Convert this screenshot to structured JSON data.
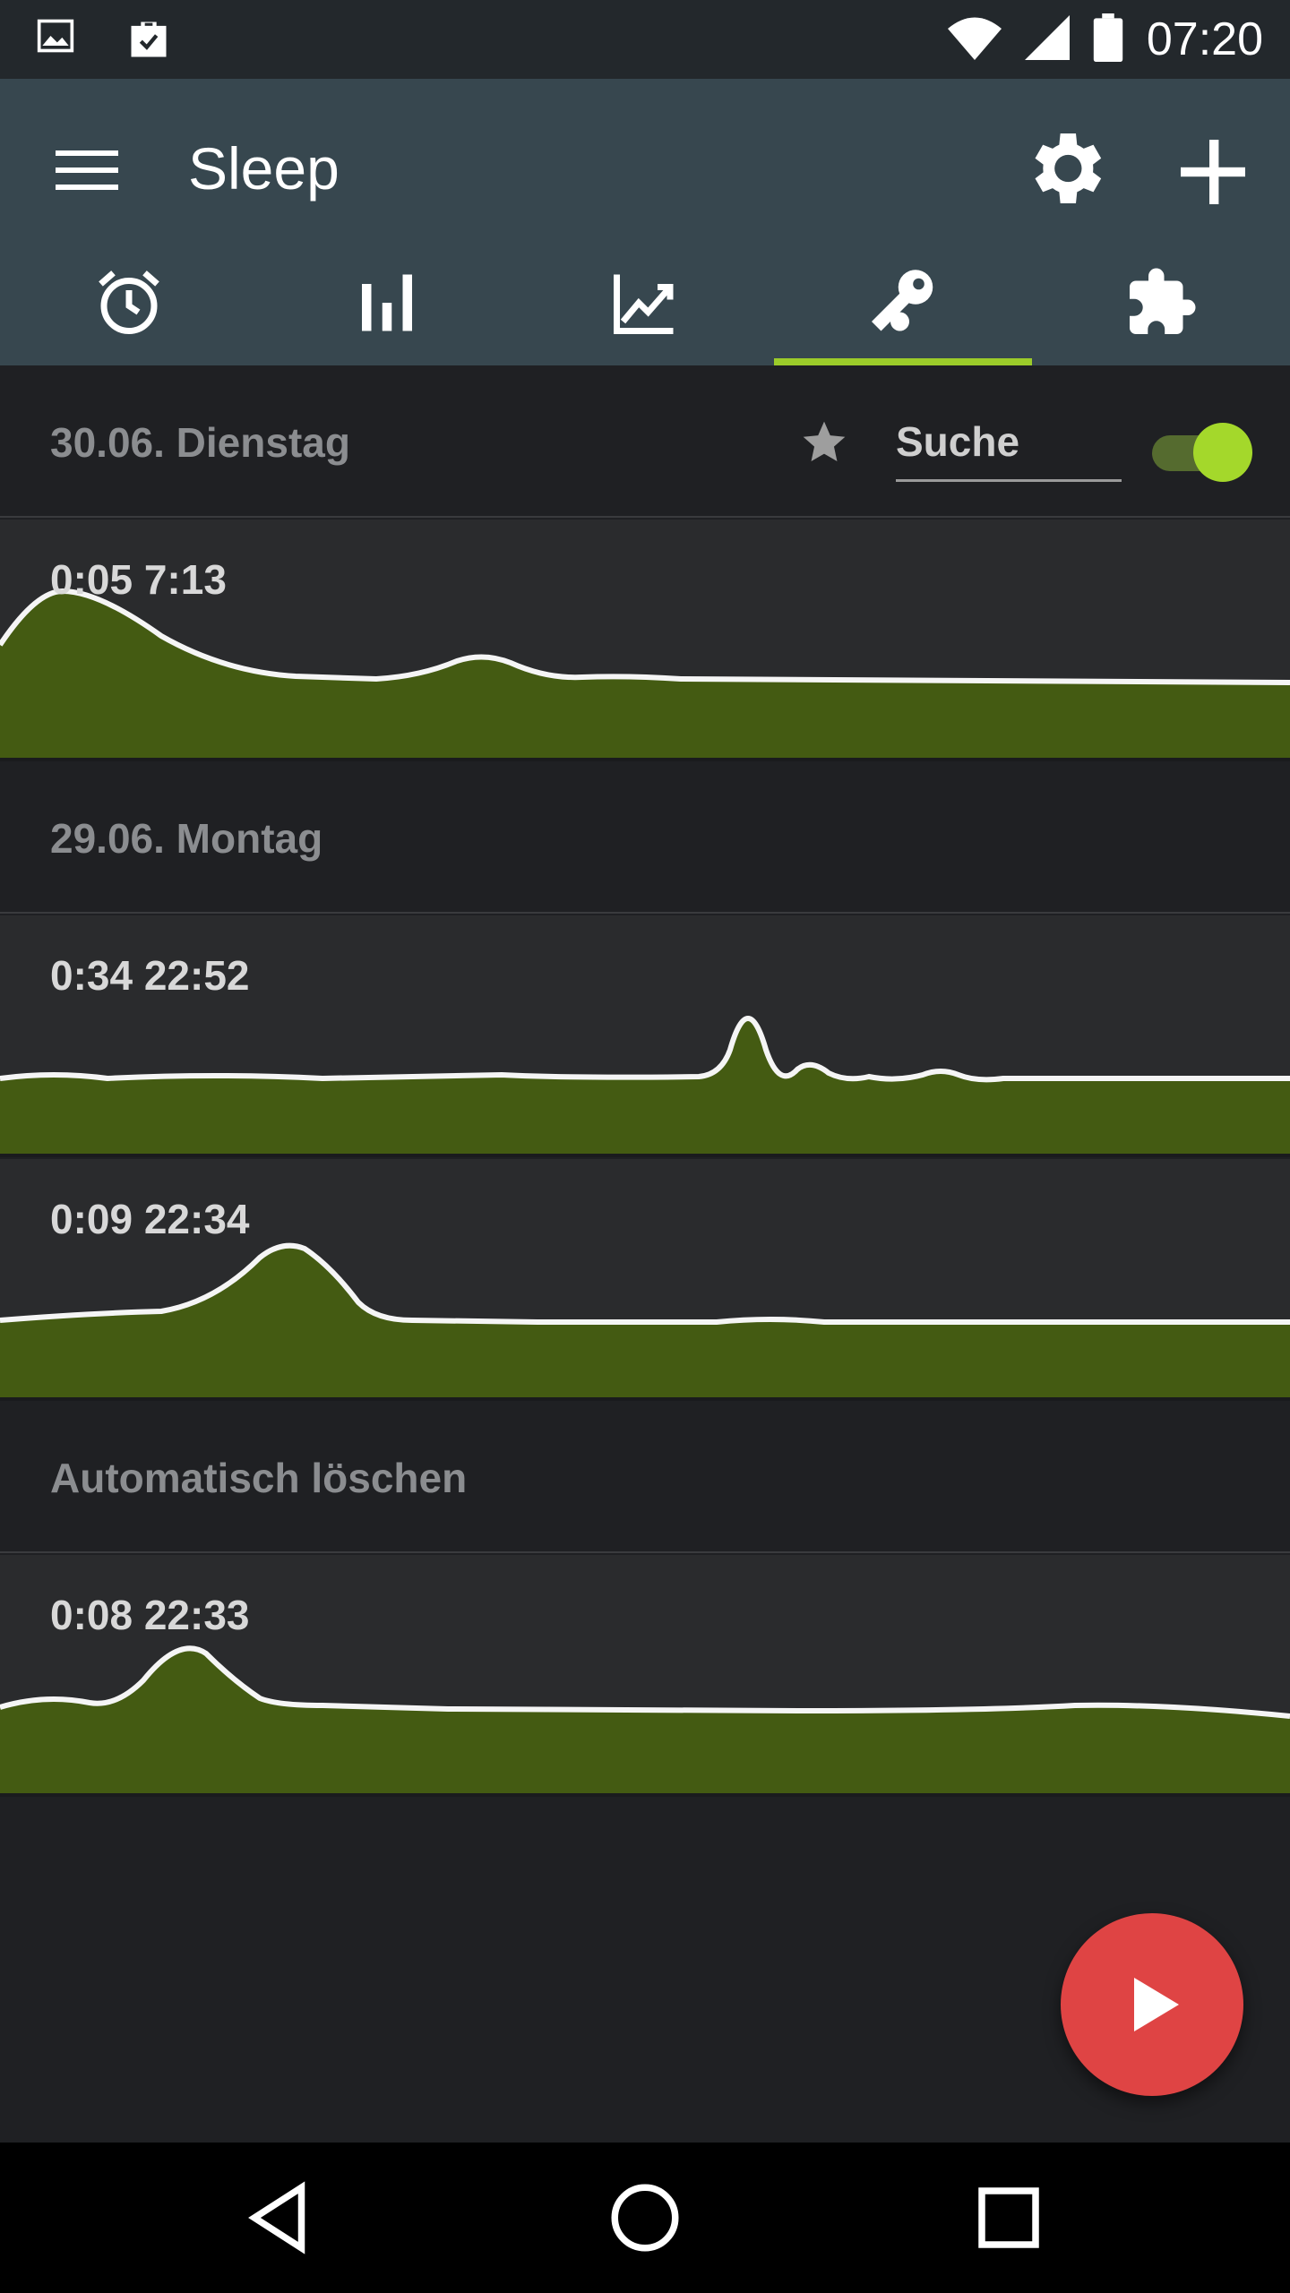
{
  "status_bar": {
    "time": "07:20",
    "icons": [
      "image-icon",
      "briefcase-check-icon",
      "wifi-icon",
      "signal-icon",
      "battery-icon"
    ]
  },
  "app_bar": {
    "title": "Sleep",
    "actions": [
      "settings-icon",
      "add-icon"
    ],
    "tabs": [
      {
        "name": "alarm-icon",
        "active": false
      },
      {
        "name": "bar-chart-icon",
        "active": false
      },
      {
        "name": "trend-chart-icon",
        "active": false
      },
      {
        "name": "key-icon",
        "active": true
      },
      {
        "name": "puzzle-icon",
        "active": false
      }
    ],
    "accent": "#9ccc2a",
    "background": "#37474f"
  },
  "list": {
    "header_1": {
      "label": "30.06. Dienstag"
    },
    "search": {
      "placeholder": "Suche",
      "value": ""
    },
    "toggle": {
      "on": true
    },
    "header_2": {
      "label": "29.06. Montag"
    },
    "header_3": {
      "label": "Automatisch löschen"
    },
    "records": [
      {
        "time": "0:05 7:13"
      },
      {
        "time": "0:34 22:52"
      },
      {
        "time": "0:09 22:34"
      },
      {
        "time": "0:08 22:33"
      }
    ]
  },
  "fab": {
    "icon": "play-icon",
    "color": "#df4444"
  },
  "nav_bar": {
    "icons": [
      "back-icon",
      "home-icon",
      "recents-icon"
    ]
  }
}
